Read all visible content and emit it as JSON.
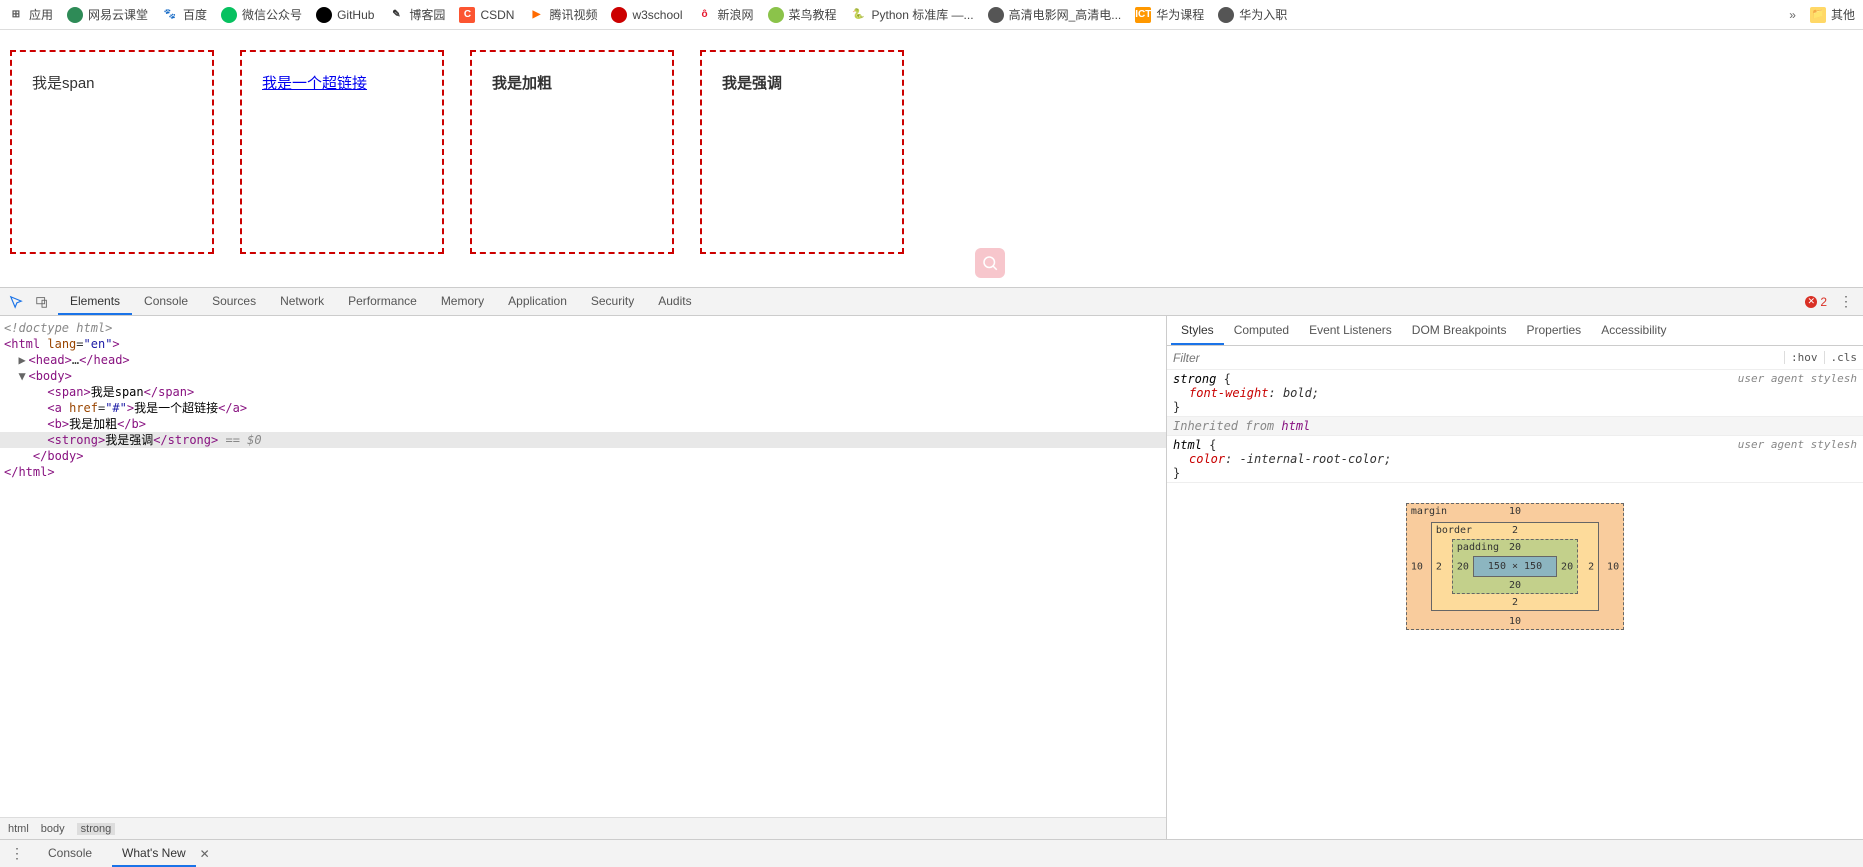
{
  "bookmarks": [
    {
      "label": "应用",
      "icon_bg": "",
      "icon_text": "⊞",
      "icon_color": "#555"
    },
    {
      "label": "网易云课堂",
      "icon_bg": "#2e8b57",
      "icon_text": "",
      "icon_color": "#fff"
    },
    {
      "label": "百度",
      "icon_bg": "",
      "icon_text": "🐾",
      "icon_color": "#2932e1"
    },
    {
      "label": "微信公众号",
      "icon_bg": "#07c160",
      "icon_text": "",
      "icon_color": "#fff"
    },
    {
      "label": "GitHub",
      "icon_bg": "#000",
      "icon_text": "",
      "icon_color": "#fff"
    },
    {
      "label": "博客园",
      "icon_bg": "",
      "icon_text": "✎",
      "icon_color": "#333"
    },
    {
      "label": "CSDN",
      "icon_bg": "#fc5531",
      "icon_text": "C",
      "icon_color": "#fff"
    },
    {
      "label": "腾讯视频",
      "icon_bg": "",
      "icon_text": "▶",
      "icon_color": "#ff6a00"
    },
    {
      "label": "w3school",
      "icon_bg": "#cc0000",
      "icon_text": "",
      "icon_color": "#fff"
    },
    {
      "label": "新浪网",
      "icon_bg": "",
      "icon_text": "ô",
      "icon_color": "#e6162d"
    },
    {
      "label": "菜鸟教程",
      "icon_bg": "#8bc34a",
      "icon_text": "",
      "icon_color": "#fff"
    },
    {
      "label": "Python 标准库 —...",
      "icon_bg": "",
      "icon_text": "🐍",
      "icon_color": "#3776ab"
    },
    {
      "label": "高清电影网_高清电...",
      "icon_bg": "#555",
      "icon_text": "",
      "icon_color": "#fff"
    },
    {
      "label": "华为课程",
      "icon_bg": "#ff9800",
      "icon_text": "ICT",
      "icon_color": "#fff"
    },
    {
      "label": "华为入职",
      "icon_bg": "#555",
      "icon_text": "",
      "icon_color": "#fff"
    }
  ],
  "bookmarks_more": "»",
  "bookmarks_other": "其他",
  "page": {
    "span_text": "我是span",
    "link_text": "我是一个超链接",
    "bold_text": "我是加粗",
    "strong_text": "我是强调"
  },
  "devtools": {
    "tabs": [
      "Elements",
      "Console",
      "Sources",
      "Network",
      "Performance",
      "Memory",
      "Application",
      "Security",
      "Audits"
    ],
    "active_tab": "Elements",
    "error_count": "2",
    "dom": {
      "doctype": "<!doctype html>",
      "html_open": "<html lang=\"en\">",
      "head": "<head>…</head>",
      "body_open": "<body>",
      "span_line": {
        "open": "<span>",
        "text": "我是span",
        "close": "</span>"
      },
      "a_line": {
        "open": "<a href=\"#\">",
        "text": "我是一个超链接",
        "close": "</a>"
      },
      "b_line": {
        "open": "<b>",
        "text": "我是加粗",
        "close": "</b>"
      },
      "strong_line": {
        "open": "<strong>",
        "text": "我是强调",
        "close": "</strong>",
        "hint": " == $0"
      },
      "body_close": "</body>",
      "html_close": "</html>"
    },
    "breadcrumb": [
      "html",
      "body",
      "strong"
    ],
    "styles": {
      "tabs": [
        "Styles",
        "Computed",
        "Event Listeners",
        "DOM Breakpoints",
        "Properties",
        "Accessibility"
      ],
      "filter_placeholder": "Filter",
      "hov": ":hov",
      "cls": ".cls",
      "rule1": {
        "selector": "strong",
        "src": "user agent stylesh",
        "props": [
          {
            "name": "font-weight",
            "val": "bold"
          }
        ]
      },
      "inherited_label": "Inherited from ",
      "inherited_tag": "html",
      "rule2": {
        "selector": "html",
        "src": "user agent stylesh",
        "props": [
          {
            "name": "color",
            "val": "-internal-root-color"
          }
        ]
      }
    },
    "boxmodel": {
      "margin_label": "margin",
      "border_label": "border",
      "padding_label": "padding",
      "margin": {
        "t": "10",
        "r": "10",
        "b": "10",
        "l": "10"
      },
      "border": {
        "t": "2",
        "r": "2",
        "b": "2",
        "l": "2"
      },
      "padding": {
        "t": "20",
        "r": "20",
        "b": "20",
        "l": "20"
      },
      "content": "150 × 150"
    },
    "drawer": {
      "tabs": [
        "Console",
        "What's New"
      ],
      "active": "What's New"
    }
  }
}
